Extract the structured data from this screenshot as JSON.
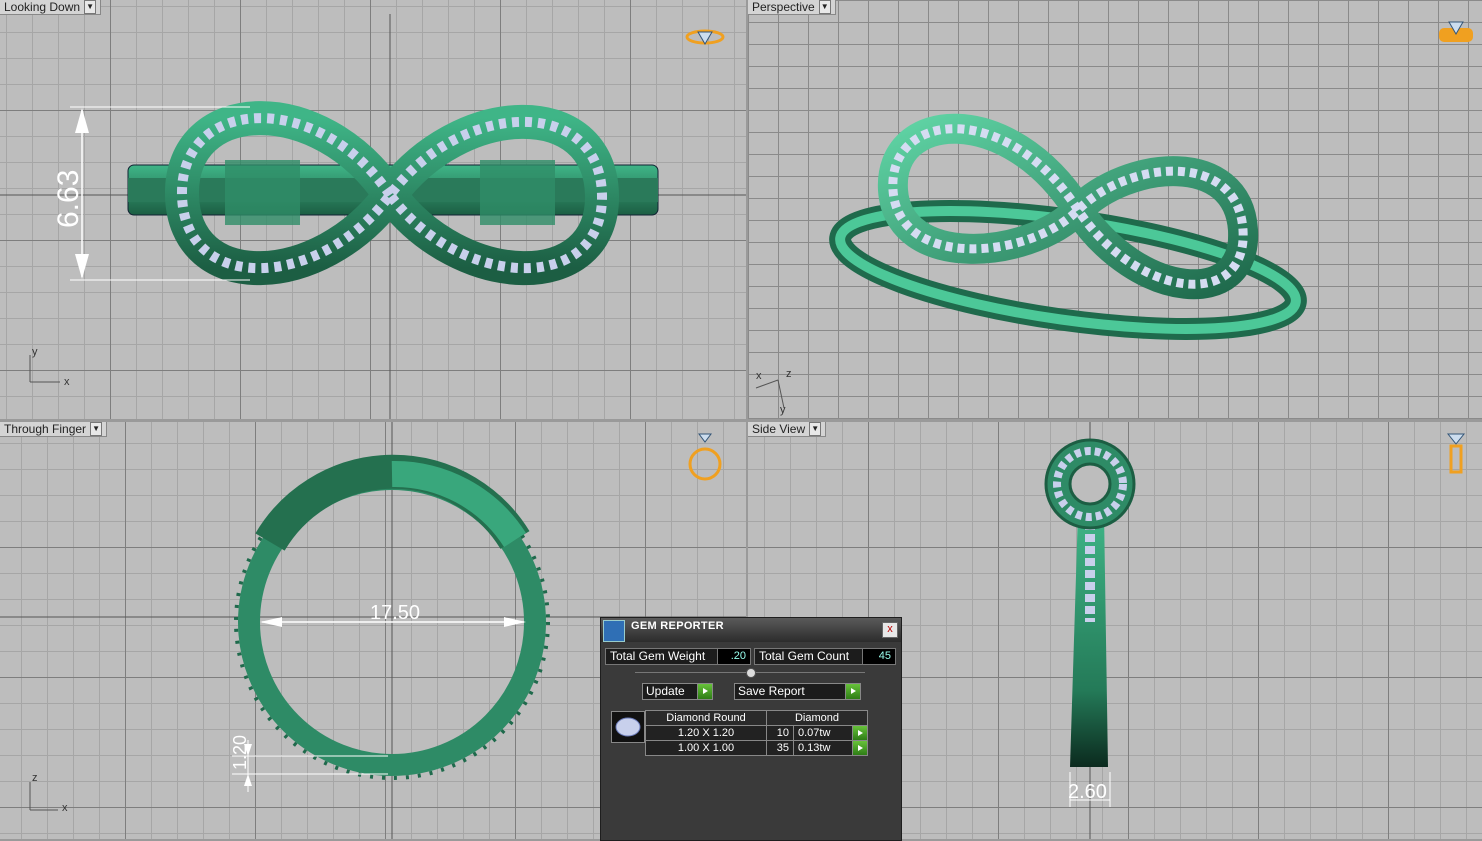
{
  "viewports": {
    "top": {
      "title": "Looking Down",
      "axis_y": "y",
      "axis_x": "x",
      "dim_height": "6.63"
    },
    "perspective": {
      "title": "Perspective",
      "axis_x": "x",
      "axis_z": "z",
      "axis_y": "y"
    },
    "front": {
      "title": "Through Finger",
      "axis_z": "z",
      "axis_x": "x",
      "dim_diameter": "17.50",
      "dim_thickness": "1.20"
    },
    "side": {
      "title": "Side View",
      "dim_width": "2.60"
    }
  },
  "gem_reporter": {
    "title": "GEM REPORTER",
    "close": "x",
    "total_weight_label": "Total Gem Weight",
    "total_weight_value": ".20",
    "total_count_label": "Total Gem Count",
    "total_count_value": "45",
    "update_label": "Update",
    "save_label": "Save Report",
    "table": {
      "headers": [
        "Diamond Round",
        "Diamond"
      ],
      "rows": [
        {
          "size": "1.20 X 1.20",
          "count": "10",
          "weight": "0.07tw"
        },
        {
          "size": "1.00 X 1.00",
          "count": "35",
          "weight": "0.13tw"
        }
      ]
    }
  },
  "colors": {
    "metal": "#2e8b66",
    "gem": "#c8d0ec",
    "accent": "#f0a020"
  }
}
